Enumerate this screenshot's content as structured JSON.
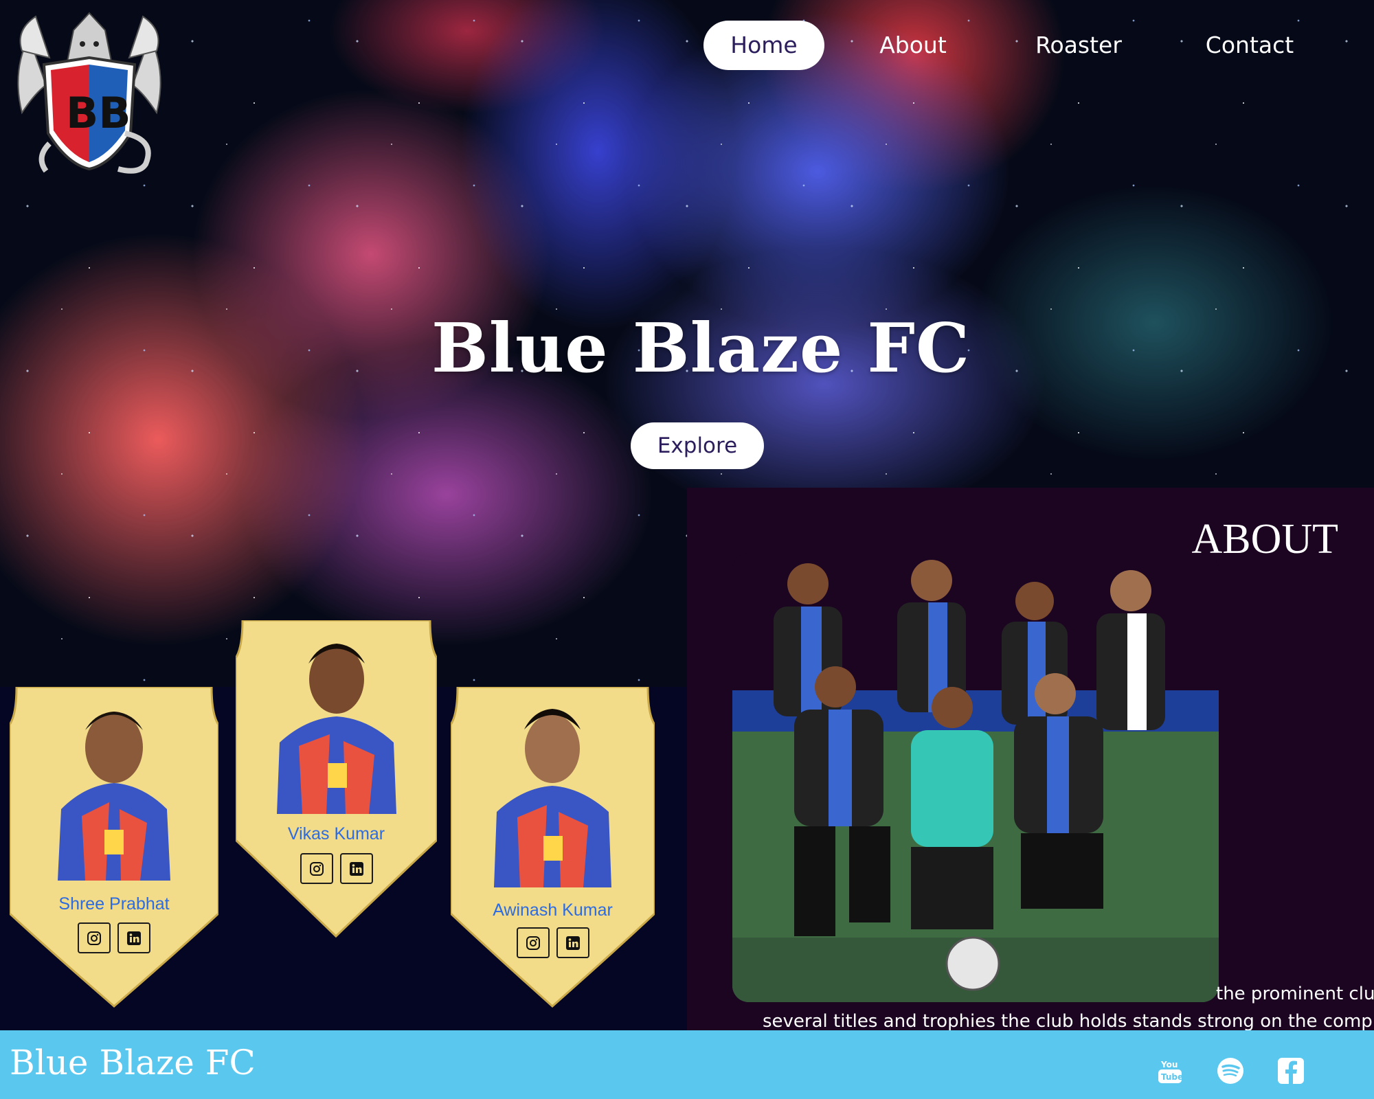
{
  "nav": {
    "items": [
      {
        "label": "Home",
        "active": true
      },
      {
        "label": "About",
        "active": false
      },
      {
        "label": "Roaster",
        "active": false
      },
      {
        "label": "Contact",
        "active": false
      }
    ]
  },
  "logo": {
    "letters": "BB"
  },
  "hero": {
    "title": "Blue Blaze FC",
    "cta": "Explore"
  },
  "players": [
    {
      "name": "Shree Prabhat",
      "icons": [
        "instagram-icon",
        "linkedin-icon"
      ]
    },
    {
      "name": "Vikas Kumar",
      "icons": [
        "instagram-icon",
        "linkedin-icon"
      ]
    },
    {
      "name": "Awinash Kumar",
      "icons": [
        "instagram-icon",
        "linkedin-icon"
      ]
    }
  ],
  "about": {
    "title": "ABOUT",
    "line1": "the prominent clu",
    "line2": "several titles and trophies the club holds stands strong on the comp"
  },
  "footer": {
    "brand": "Blue Blaze FC",
    "icons": [
      "youtube-icon",
      "spotify-icon",
      "facebook-icon"
    ]
  },
  "colors": {
    "accent": "#5ac7ef",
    "player_name": "#2d6be0",
    "nav_active_text": "#2c1d5c",
    "card_gold": "#f2dc8a",
    "panel_dark": "#040623",
    "about_bg": "#1c0521"
  }
}
